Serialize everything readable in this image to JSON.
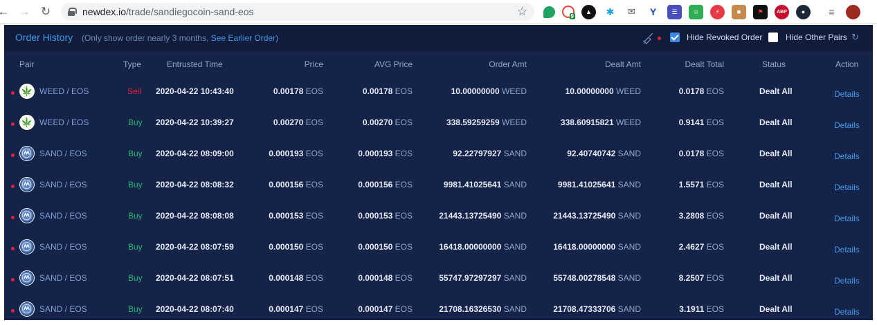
{
  "browser": {
    "url_host": "newdex.io",
    "url_path": "/trade/sandiegocoin-sand-eos",
    "extension_badge": "9",
    "abp_label": "ABP"
  },
  "panel": {
    "title": "Order History",
    "note_prefix": "(Only show order nearly 3 months, ",
    "note_link": "See Earlier Order",
    "note_suffix": ")",
    "hide_revoked_label": "Hide Revoked Order",
    "hide_revoked_checked": true,
    "hide_other_label": "Hide Other Pairs",
    "hide_other_checked": false
  },
  "columns": {
    "pair": "Pair",
    "type": "Type",
    "time": "Entrusted Time",
    "price": "Price",
    "avg": "AVG Price",
    "order_amt": "Order Amt",
    "dealt_amt": "Dealt Amt",
    "dealt_total": "Dealt Total",
    "status": "Status",
    "action": "Action"
  },
  "orders": [
    {
      "pair": "WEED / EOS",
      "coin": "weed",
      "type": "Sell",
      "time": "2020-04-22 10:43:40",
      "price": "0.00178",
      "price_unit": "EOS",
      "avg": "0.00178",
      "avg_unit": "EOS",
      "order_amt": "10.00000000",
      "order_unit": "WEED",
      "dealt_amt": "10.00000000",
      "dealt_unit": "WEED",
      "total": "0.0178",
      "total_unit": "EOS",
      "status": "Dealt All",
      "action": "Details"
    },
    {
      "pair": "WEED / EOS",
      "coin": "weed",
      "type": "Buy",
      "time": "2020-04-22 10:39:27",
      "price": "0.00270",
      "price_unit": "EOS",
      "avg": "0.00270",
      "avg_unit": "EOS",
      "order_amt": "338.59259259",
      "order_unit": "WEED",
      "dealt_amt": "338.60915821",
      "dealt_unit": "WEED",
      "total": "0.9141",
      "total_unit": "EOS",
      "status": "Dealt All",
      "action": "Details"
    },
    {
      "pair": "SAND / EOS",
      "coin": "sand",
      "type": "Buy",
      "time": "2020-04-22 08:09:00",
      "price": "0.000193",
      "price_unit": "EOS",
      "avg": "0.000193",
      "avg_unit": "EOS",
      "order_amt": "92.22797927",
      "order_unit": "SAND",
      "dealt_amt": "92.40740742",
      "dealt_unit": "SAND",
      "total": "0.0178",
      "total_unit": "EOS",
      "status": "Dealt All",
      "action": "Details"
    },
    {
      "pair": "SAND / EOS",
      "coin": "sand",
      "type": "Buy",
      "time": "2020-04-22 08:08:32",
      "price": "0.000156",
      "price_unit": "EOS",
      "avg": "0.000156",
      "avg_unit": "EOS",
      "order_amt": "9981.41025641",
      "order_unit": "SAND",
      "dealt_amt": "9981.41025641",
      "dealt_unit": "SAND",
      "total": "1.5571",
      "total_unit": "EOS",
      "status": "Dealt All",
      "action": "Details"
    },
    {
      "pair": "SAND / EOS",
      "coin": "sand",
      "type": "Buy",
      "time": "2020-04-22 08:08:08",
      "price": "0.000153",
      "price_unit": "EOS",
      "avg": "0.000153",
      "avg_unit": "EOS",
      "order_amt": "21443.13725490",
      "order_unit": "SAND",
      "dealt_amt": "21443.13725490",
      "dealt_unit": "SAND",
      "total": "3.2808",
      "total_unit": "EOS",
      "status": "Dealt All",
      "action": "Details"
    },
    {
      "pair": "SAND / EOS",
      "coin": "sand",
      "type": "Buy",
      "time": "2020-04-22 08:07:59",
      "price": "0.000150",
      "price_unit": "EOS",
      "avg": "0.000150",
      "avg_unit": "EOS",
      "order_amt": "16418.00000000",
      "order_unit": "SAND",
      "dealt_amt": "16418.00000000",
      "dealt_unit": "SAND",
      "total": "2.4627",
      "total_unit": "EOS",
      "status": "Dealt All",
      "action": "Details"
    },
    {
      "pair": "SAND / EOS",
      "coin": "sand",
      "type": "Buy",
      "time": "2020-04-22 08:07:51",
      "price": "0.000148",
      "price_unit": "EOS",
      "avg": "0.000148",
      "avg_unit": "EOS",
      "order_amt": "55747.97297297",
      "order_unit": "SAND",
      "dealt_amt": "55748.00278548",
      "dealt_unit": "SAND",
      "total": "8.2507",
      "total_unit": "EOS",
      "status": "Dealt All",
      "action": "Details"
    },
    {
      "pair": "SAND / EOS",
      "coin": "sand",
      "type": "Buy",
      "time": "2020-04-22 08:07:40",
      "price": "0.000147",
      "price_unit": "EOS",
      "avg": "0.000147",
      "avg_unit": "EOS",
      "order_amt": "21708.16326530",
      "order_unit": "SAND",
      "dealt_amt": "21708.47333706",
      "dealt_unit": "SAND",
      "total": "3.1911",
      "total_unit": "EOS",
      "status": "Dealt All",
      "action": "Details"
    }
  ],
  "colors": {
    "panel_bg": "#152348",
    "header_bg": "#111c3c",
    "accent_blue": "#3d9be9",
    "sell_red": "#e3223a",
    "buy_green": "#1fb871"
  }
}
